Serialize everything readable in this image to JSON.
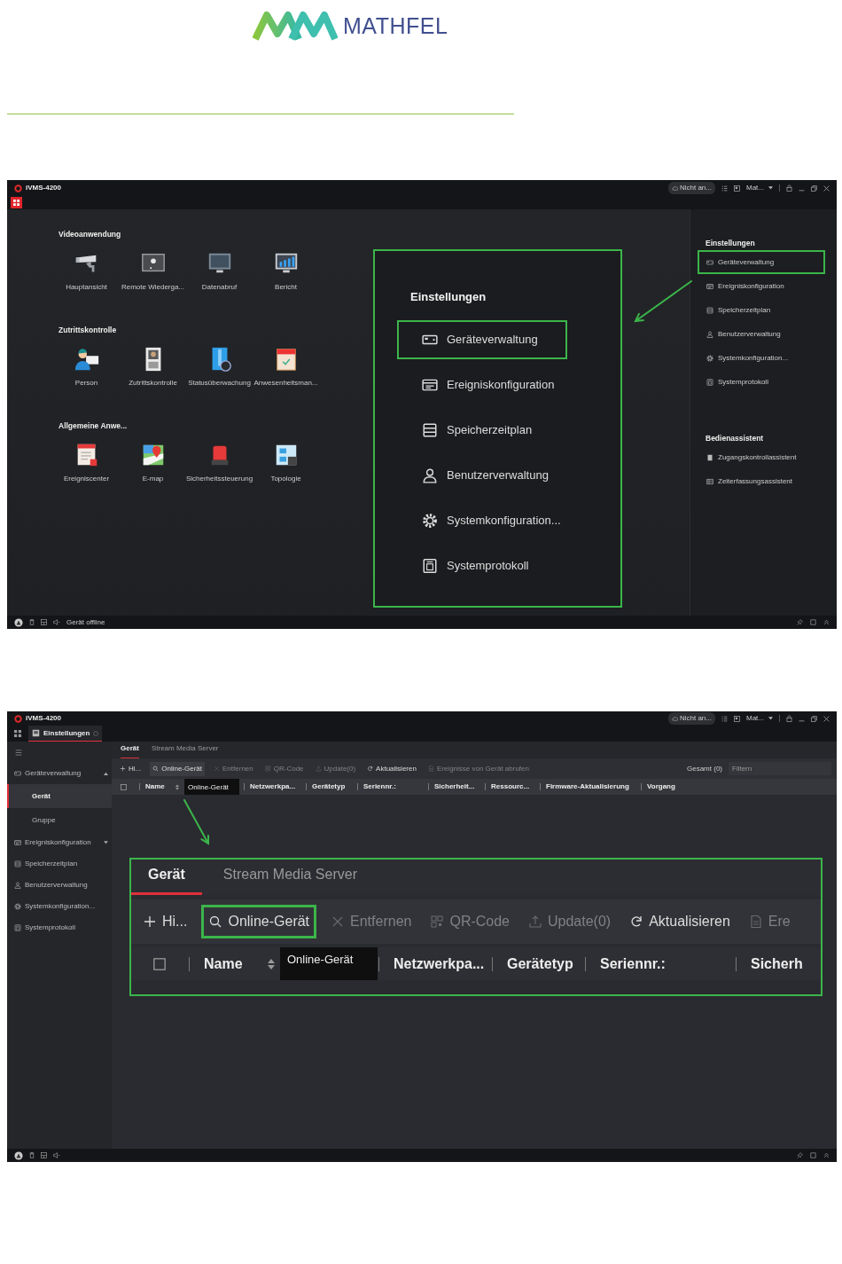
{
  "logo": {
    "text": "MATHFEL"
  },
  "home_screen": {
    "title": "iVMS-4200",
    "cloud_status": "Nicht an...",
    "user": "Mat...",
    "sections": [
      {
        "title": "Videoanwendung",
        "apps": [
          "Hauptansicht",
          "Remote Wiederga...",
          "Datenabruf",
          "Bericht"
        ]
      },
      {
        "title": "Zutrittskontrolle",
        "apps": [
          "Person",
          "Zutrittskontrolle",
          "Statusüberwachung",
          "Anwesenheitsman..."
        ]
      },
      {
        "title": "Allgemeine Anwe...",
        "apps": [
          "Ereigniscenter",
          "E-map",
          "Sicherheitssteuerung",
          "Topologie"
        ]
      }
    ],
    "callout": {
      "title": "Einstellungen",
      "items": [
        {
          "label": "Geräteverwaltung",
          "highlighted": true
        },
        {
          "label": "Ereigniskonfiguration",
          "highlighted": false
        },
        {
          "label": "Speicherzeitplan",
          "highlighted": false
        },
        {
          "label": "Benutzerverwaltung",
          "highlighted": false
        },
        {
          "label": "Systemkonfiguration...",
          "highlighted": false
        },
        {
          "label": "Systemprotokoll",
          "highlighted": false
        }
      ]
    },
    "side_panel": [
      {
        "title": "Einstellungen",
        "items": [
          {
            "label": "Geräteverwaltung",
            "highlighted": true
          },
          {
            "label": "Ereigniskonfiguration",
            "highlighted": false
          },
          {
            "label": "Speicherzeitplan",
            "highlighted": false
          },
          {
            "label": "Benutzerverwaltung",
            "highlighted": false
          },
          {
            "label": "Systemkonfiguration...",
            "highlighted": false
          },
          {
            "label": "Systemprotokoll",
            "highlighted": false
          }
        ]
      },
      {
        "title": "Bedienassistent",
        "items": [
          {
            "label": "Zugangskontrollassistent",
            "highlighted": false
          },
          {
            "label": "Zeiterfassungsassistent",
            "highlighted": false
          }
        ]
      }
    ],
    "status_text": "Gerät offline"
  },
  "device_screen": {
    "title": "iVMS-4200",
    "cloud_status": "Nicht an...",
    "user": "Mat...",
    "module_tabs": [
      {
        "label": "Einstellungen",
        "selected": true
      }
    ],
    "sidebar": [
      {
        "label": "Geräteverwaltung",
        "kind": "group",
        "expanded": true,
        "children": [
          {
            "label": "Gerät",
            "selected": true
          },
          {
            "label": "Gruppe",
            "selected": false
          }
        ]
      },
      {
        "label": "Ereigniskonfiguration",
        "kind": "group",
        "expanded": false
      },
      {
        "label": "Speicherzeitplan",
        "kind": "page"
      },
      {
        "label": "Benutzerverwaltung",
        "kind": "page"
      },
      {
        "label": "Systemkonfiguration...",
        "kind": "page"
      },
      {
        "label": "Systemprotokoll",
        "kind": "page"
      }
    ],
    "tabs": [
      {
        "label": "Gerät",
        "selected": true
      },
      {
        "label": "Stream Media Server",
        "selected": false
      }
    ],
    "toolbar": [
      {
        "label": "Hi...",
        "disabled": false,
        "highlighted": false
      },
      {
        "label": "Online-Gerät",
        "disabled": false,
        "highlighted": true
      },
      {
        "label": "Entfernen",
        "disabled": true,
        "highlighted": false
      },
      {
        "label": "QR-Code",
        "disabled": true,
        "highlighted": false
      },
      {
        "label": "Update(0)",
        "disabled": true,
        "highlighted": false
      },
      {
        "label": "Aktualisieren",
        "disabled": false,
        "highlighted": false
      },
      {
        "label": "Ereignisse von Gerät abrufen",
        "disabled": true,
        "highlighted": false
      }
    ],
    "total": "Gesamt (0)",
    "filter": {
      "placeholder": "Filtern"
    },
    "select_all": {
      "checked": false
    },
    "columns": [
      "Name",
      "Netzwerkpa...",
      "Gerätetyp",
      "Seriennr.:",
      "Sicherheit...",
      "Ressourc...",
      "Firmware-Aktualisierung",
      "Vorgang"
    ],
    "tooltip": "Online-Gerät",
    "zoom_inset": {
      "tabs": [
        {
          "label": "Gerät",
          "selected": true
        },
        {
          "label": "Stream Media Server",
          "selected": false
        }
      ],
      "toolbar": [
        {
          "label": "Hi...",
          "disabled": false,
          "highlighted": false
        },
        {
          "label": "Online-Gerät",
          "disabled": false,
          "highlighted": true
        },
        {
          "label": "Entfernen",
          "disabled": true,
          "highlighted": false
        },
        {
          "label": "QR-Code",
          "disabled": true,
          "highlighted": false
        },
        {
          "label": "Update(0)",
          "disabled": true,
          "highlighted": false
        },
        {
          "label": "Aktualisieren",
          "disabled": false,
          "highlighted": false
        },
        {
          "label": "Ere",
          "disabled": true,
          "highlighted": false
        }
      ],
      "select_all": {
        "checked": false
      },
      "columns": [
        "Name",
        "Netzwerkpa...",
        "Gerätetyp",
        "Seriennr.:",
        "Sicherh"
      ],
      "tooltip": "Online-Gerät"
    }
  }
}
